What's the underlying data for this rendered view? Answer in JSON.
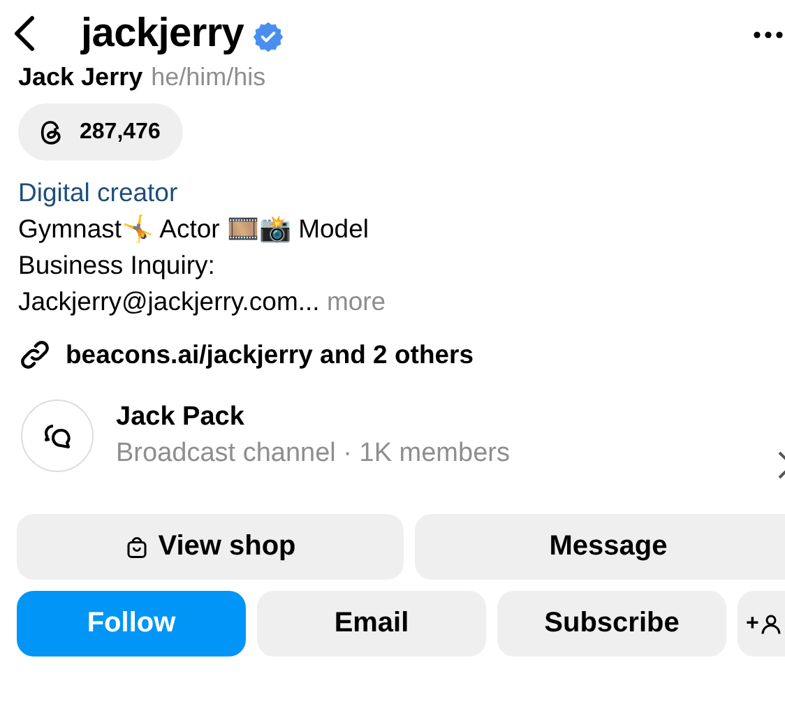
{
  "header": {
    "username": "jackjerry",
    "verified": true
  },
  "profile": {
    "name": "Jack Jerry",
    "pronouns": "he/him/his",
    "threads_count": "287,476"
  },
  "bio": {
    "category": "Digital creator",
    "lines": [
      "Gymnast🤸 Actor 🎞️📸 Model",
      "Business Inquiry:"
    ],
    "last_line": "Jackjerry@jackjerry.com...",
    "more": "more"
  },
  "link": "beacons.ai/jackjerry and 2 others",
  "channel": {
    "name": "Jack Pack",
    "subtitle": "Broadcast channel · 1K members"
  },
  "buttons_row_1": [
    {
      "kind": "shop",
      "label": "View shop"
    },
    {
      "kind": "plain",
      "label": "Message"
    }
  ],
  "buttons_row_2": [
    {
      "kind": "primary",
      "label": "Follow"
    },
    {
      "kind": "plain",
      "label": "Email"
    },
    {
      "kind": "plain",
      "label": "Subscribe"
    },
    {
      "kind": "add-person",
      "label": "+"
    }
  ]
}
